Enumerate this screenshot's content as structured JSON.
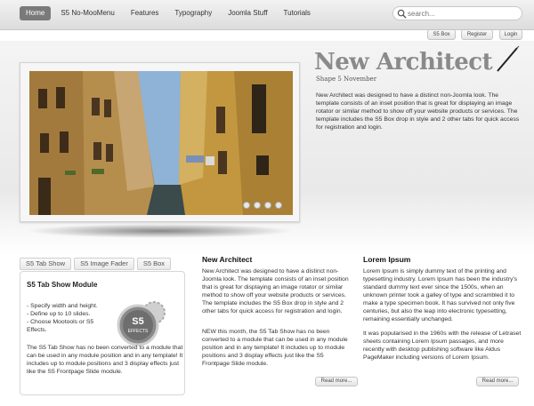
{
  "nav": {
    "items": [
      "Home",
      "S5 No-MooMenu",
      "Features",
      "Typography",
      "Joomla Stuff",
      "Tutorials"
    ],
    "active": "Home"
  },
  "search": {
    "placeholder": "search..."
  },
  "top_buttons": [
    "S5 Box",
    "Register",
    "Login"
  ],
  "hero": {
    "logo_text": "New Architect",
    "subtitle": "Shape 5 November",
    "intro": "New Architect was designed to have a distinct non-Joomla look. The template consists of an inset position that is great for displaying an image rotator or similar method to show off your website products or services. The template includes the S5 Box drop in style and 2 other tabs for quick access for registration and login."
  },
  "tabs": [
    "S5 Tab Show",
    "S5 Image Fader",
    "S5 Box"
  ],
  "module": {
    "title": "S5 Tab Show Module",
    "features": [
      "- Specify width and height.",
      "- Define up to 10 slides.",
      "- Choose Mootools or S5",
      "Effects."
    ],
    "desc": "The S5 Tab Show has no been converted to a module that can be used in any module position and in any template! It includes up to module positions and 3 display effects just like the S5 Frontpage Slide module.",
    "badge_line1": "S5",
    "badge_line2": "EFFECTS"
  },
  "columns": [
    {
      "title": "New Architect",
      "p1": "New Architect was designed to have a distinct non-Joomla look. The template consists of an inset position that is great for displaying an image rotator or similar method to show off your website products or services. The template includes the S5 Box drop in style and 2 other tabs for quick access for registration and login.",
      "p2": "NEW this month, the S5 Tab Show has no been converted to a module that can be used in any module position and in any template! It includes up to module positions and 3 display effects just like the S5 Frontpage Slide module.",
      "read_more": "Read more..."
    },
    {
      "title": "Lorem Ipsum",
      "p1": "Lorem Ipsum is simply dummy text of the printing and typesetting industry. Lorem Ipsum has been the industry's standard dummy text ever since the 1500s, when an unknown printer took a galley of type and scrambled it to make a type specimen book. It has survived not only five centuries, but also the leap into electronic typesetting, remaining essentially unchanged.",
      "p2": "It was popularised in the 1960s with the release of Letraset sheets containing Lorem Ipsum passages, and more recently with desktop publishing software like Aldus PageMaker including versions of Lorem Ipsum.",
      "read_more": "Read more..."
    }
  ],
  "slider": {
    "dot_count": 4,
    "active_dot": 1
  },
  "colors": {
    "accent_grey": "#7a7a7a",
    "band": "#ececec"
  }
}
